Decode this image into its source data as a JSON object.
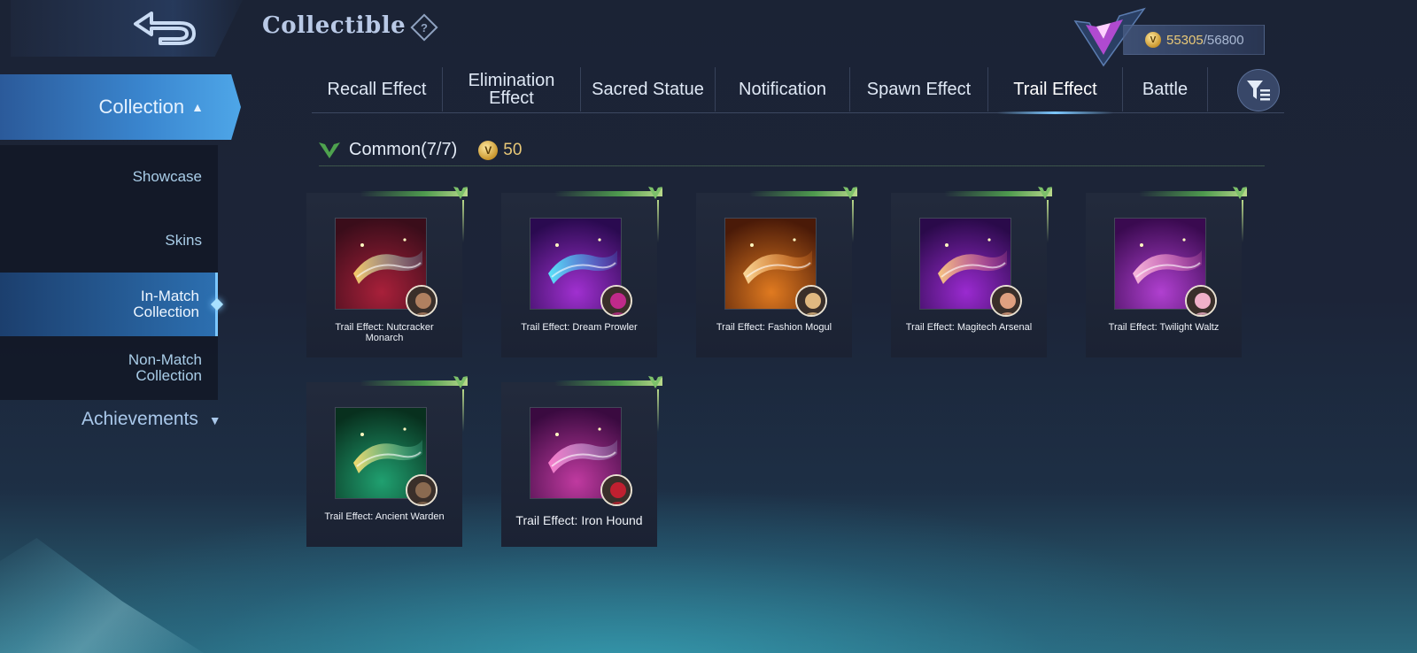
{
  "header": {
    "title": "Collectible",
    "help_icon": "question-diamond-icon",
    "currency_current": "55305",
    "currency_max": "/56800",
    "currency_icon": "v-coin-icon"
  },
  "sidebar": {
    "collection_label": "Collection",
    "items": [
      {
        "label": "Showcase",
        "active": false
      },
      {
        "label": "Skins",
        "active": false
      },
      {
        "label": "In-Match\nCollection",
        "active": true
      },
      {
        "label": "Non-Match\nCollection",
        "active": false
      }
    ],
    "achievements_label": "Achievements"
  },
  "tabs": [
    {
      "label": "Recall Effect",
      "active": false
    },
    {
      "label": "Elimination\nEffect",
      "active": false
    },
    {
      "label": "Sacred Statue",
      "active": false
    },
    {
      "label": "Notification",
      "active": false
    },
    {
      "label": "Spawn Effect",
      "active": false
    },
    {
      "label": "Trail Effect",
      "active": true
    },
    {
      "label": "Battle",
      "active": false
    }
  ],
  "section": {
    "title": "Common(7/7)",
    "cost": "50"
  },
  "cards": [
    {
      "label": "Trail Effect: Nutcracker\nMonarch",
      "bg": [
        "#a8203a",
        "#3a0d1a"
      ],
      "trail": [
        "#ffd36a",
        "#7fe0ff"
      ],
      "avatar": "#b08060",
      "large": false
    },
    {
      "label": "Trail Effect: Dream Prowler",
      "bg": [
        "#a030d0",
        "#2a0a50"
      ],
      "trail": [
        "#5af0ff",
        "#3aa0ff"
      ],
      "avatar": "#c02a8a",
      "large": false
    },
    {
      "label": "Trail Effect: Fashion Mogul",
      "bg": [
        "#e07a20",
        "#4a1a08"
      ],
      "trail": [
        "#ffe0a0",
        "#ff8a2a"
      ],
      "avatar": "#e0b880",
      "large": false
    },
    {
      "label": "Trail Effect: Magitech Arsenal",
      "bg": [
        "#9a2ad0",
        "#2a0a4a"
      ],
      "trail": [
        "#ffd080",
        "#ff70a0"
      ],
      "avatar": "#e0a080",
      "large": false
    },
    {
      "label": "Trail Effect: Twilight Waltz",
      "bg": [
        "#b040d0",
        "#3a0a50"
      ],
      "trail": [
        "#ffc0e0",
        "#ff80c0"
      ],
      "avatar": "#f0b0c8",
      "large": false
    },
    {
      "label": "Trail Effect: Ancient Warden",
      "bg": [
        "#20a070",
        "#08301e"
      ],
      "trail": [
        "#ffe070",
        "#60e0c0"
      ],
      "avatar": "#8a6a50",
      "large": false
    },
    {
      "label": "Trail Effect: Iron Hound",
      "bg": [
        "#c03aa0",
        "#3a0a40"
      ],
      "trail": [
        "#ff80d0",
        "#c0e0ff"
      ],
      "avatar": "#c02030",
      "large": true
    }
  ],
  "colors": {
    "accent": "#4ea6e8",
    "gold": "#e8c878",
    "green_trim": "#4e9a4e"
  }
}
